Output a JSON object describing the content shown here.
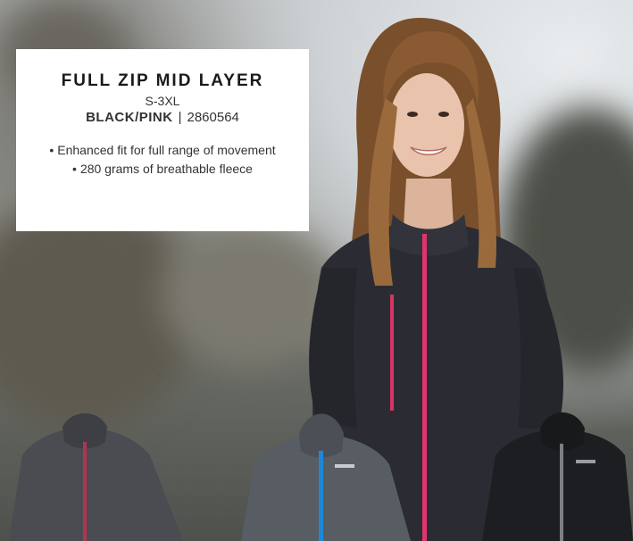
{
  "product": {
    "title": "FULL ZIP MID LAYER",
    "sizes": "S-3XL",
    "color": "BLACK/PINK",
    "separator": "|",
    "sku": "2860564",
    "features": [
      "Enhanced fit for full range of movement",
      "280 grams of breathable fleece"
    ]
  },
  "photo": {
    "subject": "woman-wearing-black-pink-full-zip-fleece",
    "thumbnails": [
      "charcoal-pink-zip-jacket",
      "gray-blue-zip-jacket",
      "black-gray-zip-jacket"
    ],
    "colors": {
      "jacket_main": "#2b2c33",
      "zip_pink": "#e0356b",
      "zip_blue": "#1e88d6",
      "hair": "#8a5a32",
      "skin": "#e9c3ab"
    }
  }
}
